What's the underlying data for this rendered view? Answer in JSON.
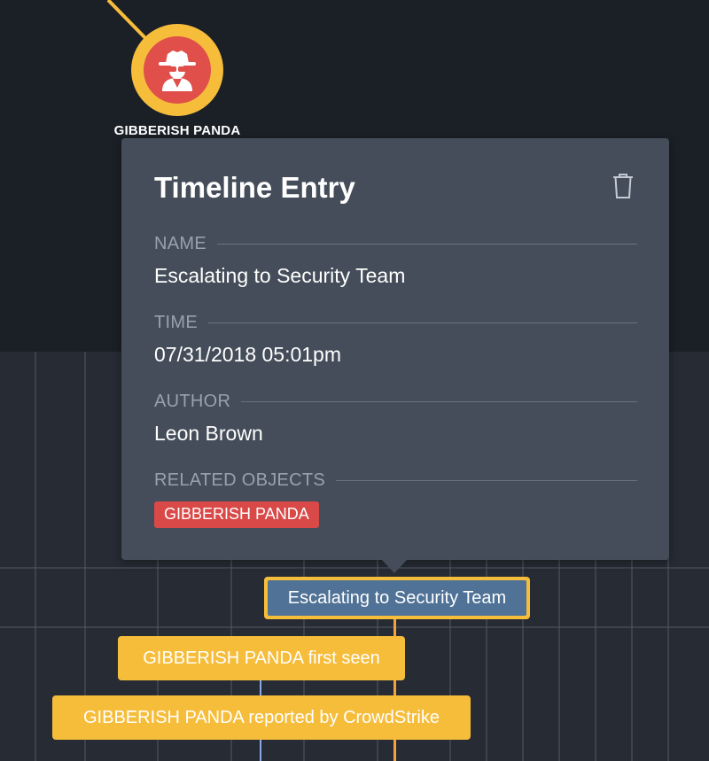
{
  "actor": {
    "name": "GIBBERISH PANDA",
    "icon": "spy-icon"
  },
  "popover": {
    "title": "Timeline Entry",
    "delete_icon": "trash-icon",
    "fields": {
      "name_label": "NAME",
      "name_value": "Escalating to Security Team",
      "time_label": "TIME",
      "time_value": "07/31/2018 05:01pm",
      "author_label": "AUTHOR",
      "author_value": "Leon Brown",
      "related_label": "RELATED OBJECTS",
      "related_tags": [
        "GIBBERISH PANDA"
      ]
    }
  },
  "timeline": {
    "entries": [
      {
        "label": "Escalating to Security Team",
        "selected": true
      },
      {
        "label": "GIBBERISH PANDA first seen",
        "selected": false
      },
      {
        "label": "GIBBERISH PANDA reported by CrowdStrike",
        "selected": false
      }
    ]
  },
  "colors": {
    "background_dark": "#1b1f26",
    "grid_background": "#262b34",
    "popover_bg": "#444d59",
    "accent_yellow": "#f6bd3b",
    "accent_red": "#e04f4a",
    "tag_red": "#d94948",
    "selected_blue": "#4f7296"
  }
}
